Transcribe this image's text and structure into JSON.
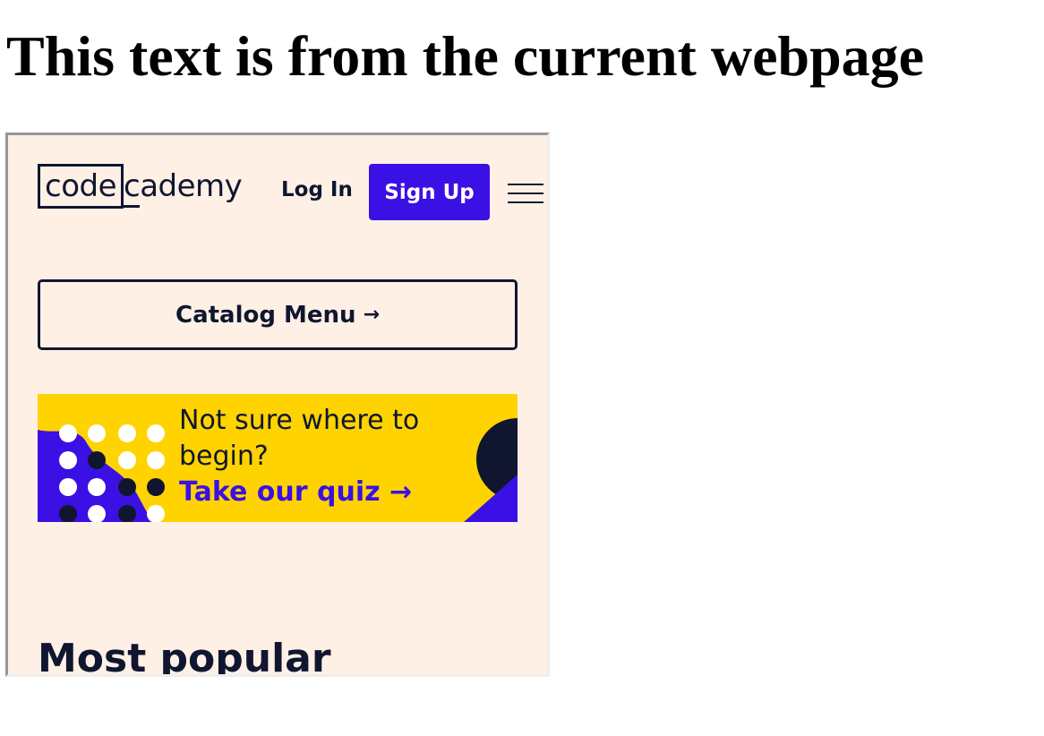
{
  "page": {
    "heading": "This text is from the current webpage"
  },
  "frame": {
    "logo": {
      "part1": "code",
      "part2_c": "c",
      "part2_rest": "ademy"
    },
    "header": {
      "login_label": "Log In",
      "signup_label": "Sign Up"
    },
    "catalog": {
      "label": "Catalog Menu",
      "arrow": "→"
    },
    "quiz": {
      "line1": "Not sure where to",
      "line2": "begin?",
      "link": "Take our quiz",
      "arrow": "→"
    },
    "section": {
      "heading": "Most popular"
    }
  },
  "colors": {
    "brand_purple": "#3a10e5",
    "navy": "#10162f",
    "yellow": "#ffd300",
    "cream": "#fff0e6"
  },
  "icons": {
    "menu": "hamburger-menu-icon",
    "arrow": "arrow-right-icon"
  }
}
